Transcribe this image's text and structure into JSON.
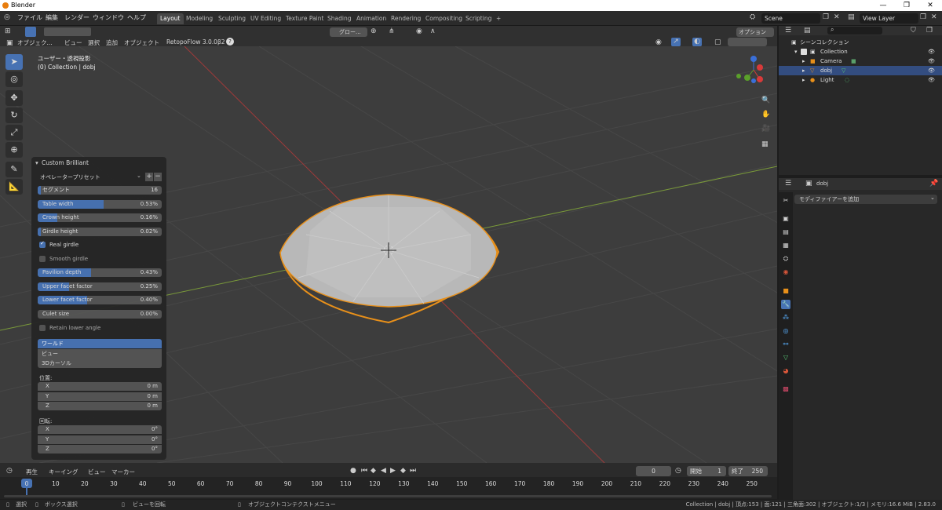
{
  "window": {
    "title": "Blender",
    "min": "—",
    "max": "❐",
    "close": "✕"
  },
  "menu": [
    "ファイル",
    "編集",
    "レンダー",
    "ウィンドウ",
    "ヘルプ"
  ],
  "workspaces": [
    "Layout",
    "Modeling",
    "Sculpting",
    "UV Editing",
    "Texture Paint",
    "Shading",
    "Animation",
    "Rendering",
    "Compositing",
    "Scripting",
    "+"
  ],
  "scene": {
    "label": "Scene",
    "view_layer": "View Layer"
  },
  "viewport_header": {
    "mode": "オブジェク...",
    "view": "ビュー",
    "select": "選択",
    "add": "追加",
    "object": "オブジェクト",
    "addon": "RetopoFlow 3.0.0β2",
    "orientation": "グロー...",
    "options": "オプション"
  },
  "viewport": {
    "view_label": "ユーザー・透視投影",
    "collection_label": "(0) Collection | dobj"
  },
  "operator_panel": {
    "title": "Custom Brilliant",
    "preset": "オペレータープリセット",
    "rows": [
      {
        "label": "セグメント",
        "value": "16",
        "fill": 0.0
      },
      {
        "label": "Table width",
        "value": "0.53%",
        "fill": 0.53
      },
      {
        "label": "Crown height",
        "value": "0.16%",
        "fill": 0.16
      },
      {
        "label": "Girdle height",
        "value": "0.02%",
        "fill": 0.02
      }
    ],
    "real_girdle": "Real girdle",
    "smooth_girdle": "Smooth girdle",
    "rows2": [
      {
        "label": "Pavilion depth",
        "value": "0.43%",
        "fill": 0.43
      },
      {
        "label": "Upper facet factor",
        "value": "0.25%",
        "fill": 0.25
      },
      {
        "label": "Lower facet factor",
        "value": "0.40%",
        "fill": 0.4
      },
      {
        "label": "Culet size",
        "value": "0.00%",
        "fill": 0.0
      }
    ],
    "retain": "Retain lower angle",
    "align": [
      "ワールド",
      "ビュー",
      "3Dカーソル"
    ],
    "location_label": "位置:",
    "location": [
      {
        "axis": "X",
        "value": "0 m"
      },
      {
        "axis": "Y",
        "value": "0 m"
      },
      {
        "axis": "Z",
        "value": "0 m"
      }
    ],
    "rotation_label": "回転:",
    "rotation": [
      {
        "axis": "X",
        "value": "0°"
      },
      {
        "axis": "Y",
        "value": "0°"
      },
      {
        "axis": "Z",
        "value": "0°"
      }
    ]
  },
  "outliner": {
    "title": "シーンコレクション",
    "items": [
      {
        "label": "Collection"
      },
      {
        "label": "Camera"
      },
      {
        "label": "dobj"
      },
      {
        "label": "Light"
      }
    ]
  },
  "properties": {
    "object": "dobj",
    "modifier": "モディファイアーを追加"
  },
  "timeline": {
    "play": "再生",
    "keying": "キーイング",
    "view": "ビュー",
    "marker": "マーカー",
    "current": "0",
    "start_label": "開始",
    "start": "1",
    "end_label": "終了",
    "end": "250",
    "frames": [
      "0",
      "10",
      "20",
      "30",
      "40",
      "50",
      "60",
      "70",
      "80",
      "90",
      "100",
      "110",
      "120",
      "130",
      "140",
      "150",
      "160",
      "170",
      "180",
      "190",
      "200",
      "210",
      "220",
      "230",
      "240",
      "250"
    ]
  },
  "status": {
    "select": "選択",
    "box": "ボックス選択",
    "rotate": "ビューを回転",
    "context": "オブジェクトコンテクストメニュー",
    "info": "Collection | dobj | 頂点:153 | 面:121 | 三角面:302 | オブジェクト:1/3 | メモリ:16.6 MiB | 2.83.0"
  }
}
